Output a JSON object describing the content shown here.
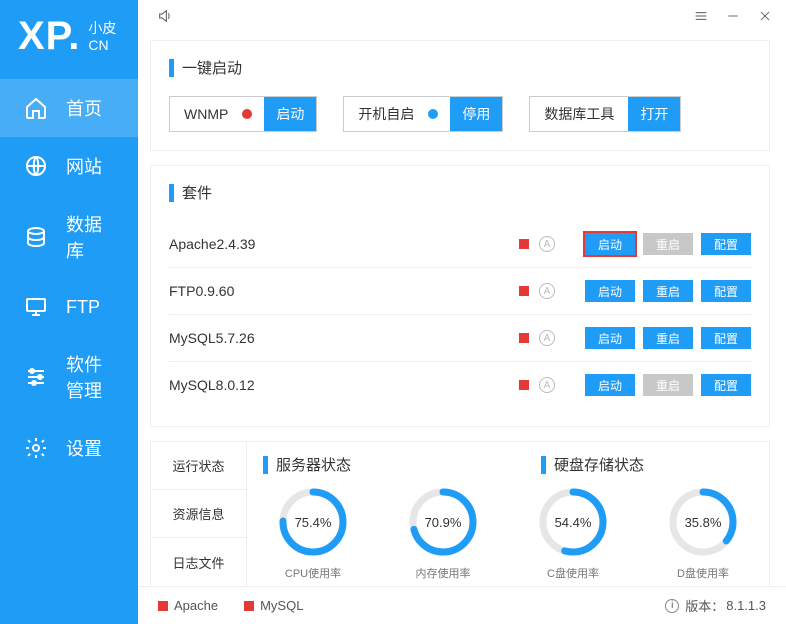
{
  "logo": {
    "big": "XP.",
    "small_top": "小皮",
    "small_bottom": "CN"
  },
  "nav": [
    {
      "label": "首页",
      "icon": "home",
      "active": true
    },
    {
      "label": "网站",
      "icon": "globe",
      "active": false
    },
    {
      "label": "数据库",
      "icon": "database",
      "active": false
    },
    {
      "label": "FTP",
      "icon": "monitor",
      "active": false
    },
    {
      "label": "软件管理",
      "icon": "sliders",
      "active": false
    },
    {
      "label": "设置",
      "icon": "gear",
      "active": false
    }
  ],
  "quickstart": {
    "title": "一键启动",
    "items": [
      {
        "label": "WNMP",
        "dot": "red",
        "btn": "启动"
      },
      {
        "label": "开机自启",
        "dot": "blue",
        "btn": "停用"
      },
      {
        "label": "数据库工具",
        "dot": null,
        "btn": "打开"
      }
    ]
  },
  "packages": {
    "title": "套件",
    "btn_start": "启动",
    "btn_restart": "重启",
    "btn_config": "配置",
    "rows": [
      {
        "name": "Apache2.4.39",
        "highlight": true,
        "restart_gray": true
      },
      {
        "name": "FTP0.9.60",
        "highlight": false,
        "restart_gray": false
      },
      {
        "name": "MySQL5.7.26",
        "highlight": false,
        "restart_gray": false
      },
      {
        "name": "MySQL8.0.12",
        "highlight": false,
        "restart_gray": true
      }
    ]
  },
  "status": {
    "tabs": [
      "运行状态",
      "资源信息",
      "日志文件"
    ],
    "title_server": "服务器状态",
    "title_disk": "硬盘存储状态",
    "gauges": [
      {
        "label": "CPU使用率",
        "value": 75.4,
        "text": "75.4%"
      },
      {
        "label": "内存使用率",
        "value": 70.9,
        "text": "70.9%"
      },
      {
        "label": "C盘使用率",
        "value": 54.4,
        "text": "54.4%"
      },
      {
        "label": "D盘使用率",
        "value": 35.8,
        "text": "35.8%"
      }
    ]
  },
  "footer": {
    "services": [
      "Apache",
      "MySQL"
    ],
    "version_label": "版本：",
    "version": "8.1.1.3"
  }
}
